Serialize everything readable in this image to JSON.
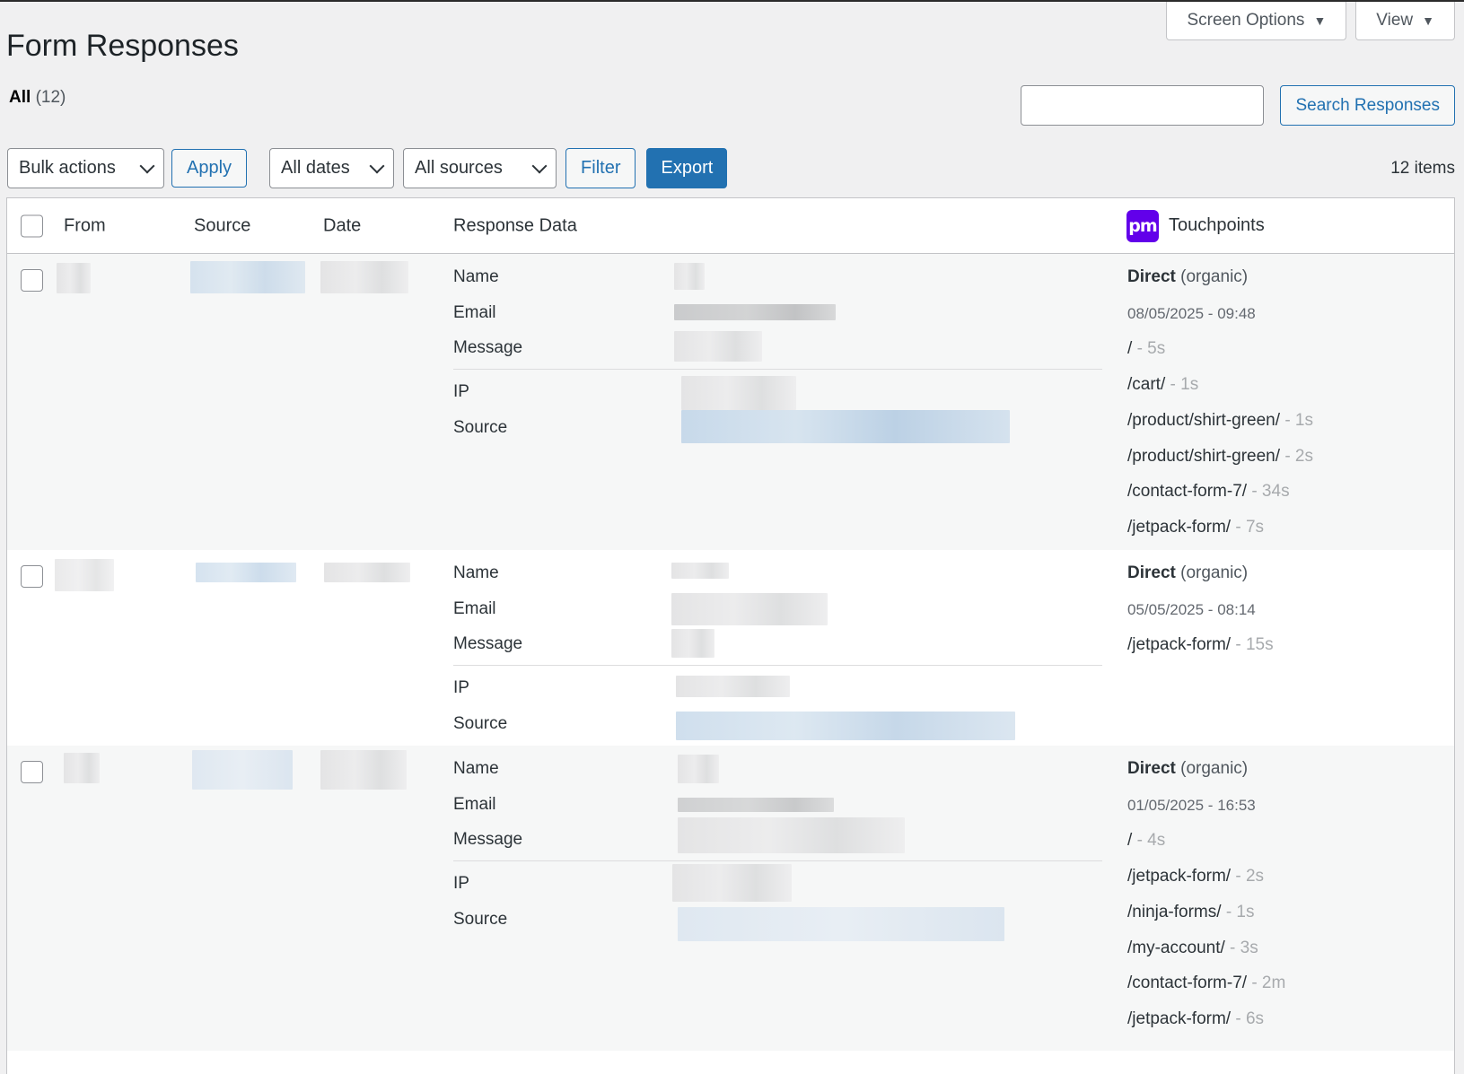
{
  "header": {
    "screen_options": "Screen Options",
    "view": "View",
    "title": "Form Responses",
    "filter_all": "All",
    "filter_all_count": "(12)",
    "search_button": "Search Responses",
    "search_value": ""
  },
  "toolbar": {
    "bulk_actions": "Bulk actions",
    "apply": "Apply",
    "all_dates": "All dates",
    "all_sources": "All sources",
    "filter": "Filter",
    "export": "Export",
    "items_count": "12 items"
  },
  "table": {
    "columns": {
      "from": "From",
      "source": "Source",
      "date": "Date",
      "response_data": "Response Data",
      "touchpoints": "Touchpoints"
    },
    "logo_text": "pm",
    "field_labels": [
      "Name",
      "Email",
      "Message",
      "IP",
      "Source"
    ],
    "rows": [
      {
        "touchpoints": {
          "channel": "Direct",
          "channel_type": "(organic)",
          "date": "08/05/2025 - 09:48",
          "pages": [
            {
              "path": "/",
              "duration": "- 5s"
            },
            {
              "path": "/cart/",
              "duration": "- 1s"
            },
            {
              "path": "/product/shirt-green/",
              "duration": "- 1s"
            },
            {
              "path": "/product/shirt-green/",
              "duration": "- 2s"
            },
            {
              "path": "/contact-form-7/",
              "duration": "- 34s"
            },
            {
              "path": "/jetpack-form/",
              "duration": "- 7s"
            }
          ]
        }
      },
      {
        "touchpoints": {
          "channel": "Direct",
          "channel_type": "(organic)",
          "date": "05/05/2025 - 08:14",
          "pages": [
            {
              "path": "/jetpack-form/",
              "duration": "- 15s"
            }
          ]
        }
      },
      {
        "touchpoints": {
          "channel": "Direct",
          "channel_type": "(organic)",
          "date": "01/05/2025 - 16:53",
          "pages": [
            {
              "path": "/",
              "duration": "- 4s"
            },
            {
              "path": "/jetpack-form/",
              "duration": "- 2s"
            },
            {
              "path": "/ninja-forms/",
              "duration": "- 1s"
            },
            {
              "path": "/my-account/",
              "duration": "- 3s"
            },
            {
              "path": "/contact-form-7/",
              "duration": "- 2m"
            },
            {
              "path": "/jetpack-form/",
              "duration": "- 6s"
            }
          ]
        }
      }
    ]
  }
}
